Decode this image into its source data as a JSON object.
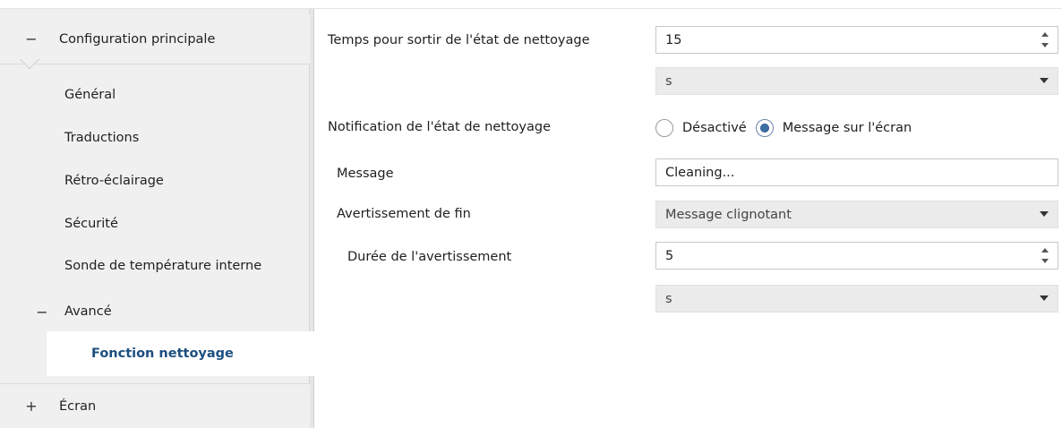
{
  "sidebar": {
    "main_section": {
      "toggle": "−",
      "label": "Configuration principale"
    },
    "items": [
      {
        "label": "Général"
      },
      {
        "label": "Traductions"
      },
      {
        "label": "Rétro-éclairage"
      },
      {
        "label": "Sécurité"
      },
      {
        "label": "Sonde de température interne"
      }
    ],
    "advanced": {
      "toggle": "−",
      "label": "Avancé"
    },
    "selected": {
      "label": "Fonction nettoyage"
    },
    "screen_section": {
      "toggle": "+",
      "label": "Écran"
    }
  },
  "form": {
    "exit_time": {
      "label": "Temps pour sortir de l'état de nettoyage",
      "value": "15",
      "unit": "s"
    },
    "notification": {
      "label": "Notification de l'état de nettoyage",
      "options": [
        {
          "label": "Désactivé",
          "checked": false
        },
        {
          "label": "Message sur l'écran",
          "checked": true
        }
      ]
    },
    "message": {
      "label": "Message",
      "value": "Cleaning..."
    },
    "end_warning": {
      "label": "Avertissement de fin",
      "value": "Message clignotant"
    },
    "warning_duration": {
      "label": "Durée de l'avertissement",
      "value": "5",
      "unit": "s"
    }
  },
  "colors": {
    "sidebar_bg": "#f0f0f0",
    "selected_text": "#1c4e80",
    "radio_checked": "#3d6ea7"
  }
}
